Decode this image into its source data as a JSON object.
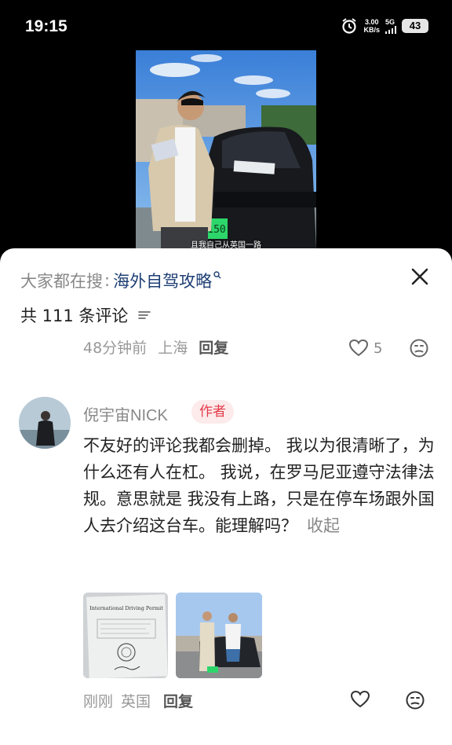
{
  "status": {
    "time": "19:15",
    "speed_value": "3.00",
    "speed_unit": "KB/s",
    "network": "5G",
    "battery": "43"
  },
  "video": {
    "plate_text": "150",
    "subtitle": "且我自己从英国一路"
  },
  "search": {
    "prefix": "大家都在搜",
    "colon": ":",
    "term": "海外自驾攻略"
  },
  "comments_header": {
    "count_text": "共 111 条评论"
  },
  "previous_comment": {
    "time": "48分钟前",
    "location": "上海",
    "reply_label": "回复",
    "like_count": "5"
  },
  "comment": {
    "author": "倪宇宙NICK",
    "badge": "作者",
    "text": "不友好的评论我都会删掉。 我以为很清晰了，为什么还有人在杠。 我说，在罗马尼亚遵守法律法规。意思就是 我没有上路，只是在停车场跟外国人去介绍这台车。能理解吗？",
    "collapse_label": "收起",
    "time": "刚刚",
    "location": "英国",
    "reply_label": "回复",
    "permit_title": "International Driving Permit"
  },
  "colors": {
    "accent_blue": "#1e3f74",
    "badge_red": "#e33a4a",
    "badge_bg": "#fdeaea"
  }
}
